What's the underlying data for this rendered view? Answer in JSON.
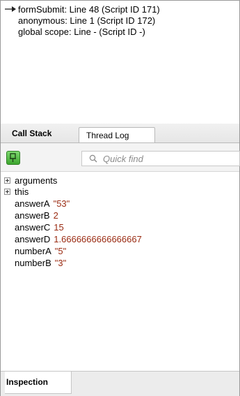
{
  "call_stack": {
    "frames": [
      {
        "label": "formSubmit: Line 48 (Script ID 171)",
        "current": true
      },
      {
        "label": "anonymous: Line 1 (Script ID 172)",
        "current": false
      },
      {
        "label": "global scope: Line - (Script ID -)",
        "current": false
      }
    ]
  },
  "tabs": {
    "active": "Call Stack",
    "inactive": "Thread Log"
  },
  "toolbar": {
    "pin_icon": "pin-icon",
    "search_icon": "search-icon",
    "search_placeholder": "Quick find",
    "accent_color": "#3ca52e"
  },
  "inspection": {
    "nodes": [
      {
        "name": "arguments",
        "expandable": true
      },
      {
        "name": "this",
        "expandable": true
      }
    ],
    "properties": [
      {
        "name": "answerA",
        "value": "\"53\""
      },
      {
        "name": "answerB",
        "value": "2"
      },
      {
        "name": "answerC",
        "value": "15"
      },
      {
        "name": "answerD",
        "value": "1.6666666666666667"
      },
      {
        "name": "numberA",
        "value": "\"5\""
      },
      {
        "name": "numberB",
        "value": "\"3\""
      }
    ],
    "value_color": "#9a2b12"
  },
  "bottom_tab": "Inspection"
}
